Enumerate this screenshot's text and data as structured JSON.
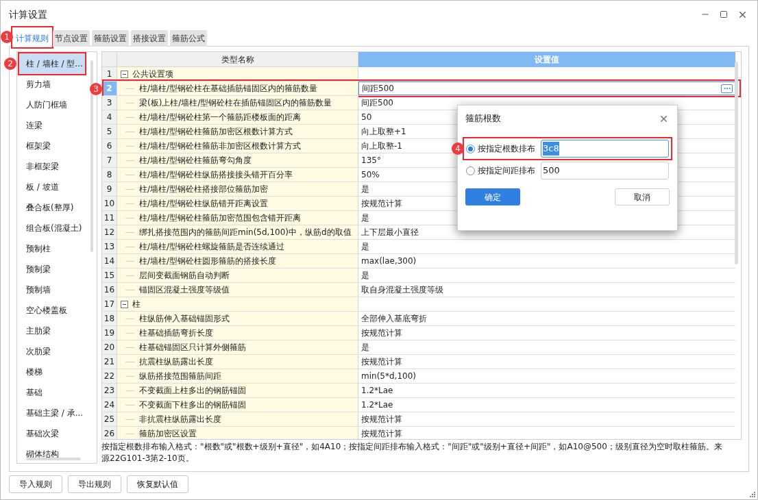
{
  "window": {
    "title": "计算设置"
  },
  "tabs": [
    {
      "label": "计算规则",
      "selected": true,
      "callout": "1"
    },
    {
      "label": "节点设置",
      "selected": false
    },
    {
      "label": "箍筋设置",
      "selected": false
    },
    {
      "label": "搭接设置",
      "selected": false
    },
    {
      "label": "箍筋公式",
      "selected": false
    }
  ],
  "sidebar": {
    "items": [
      {
        "label": "柱 / 墙柱 / 型...",
        "selected": true,
        "callout": "2"
      },
      {
        "label": "剪力墙",
        "selected": false
      },
      {
        "label": "人防门框墙",
        "selected": false
      },
      {
        "label": "连梁",
        "selected": false
      },
      {
        "label": "框架梁",
        "selected": false
      },
      {
        "label": "非框架梁",
        "selected": false
      },
      {
        "label": "板 / 坡道",
        "selected": false
      },
      {
        "label": "叠合板(整厚)",
        "selected": false
      },
      {
        "label": "组合板(混凝土)",
        "selected": false
      },
      {
        "label": "预制柱",
        "selected": false
      },
      {
        "label": "预制梁",
        "selected": false
      },
      {
        "label": "预制墙",
        "selected": false
      },
      {
        "label": "空心楼盖板",
        "selected": false
      },
      {
        "label": "主肋梁",
        "selected": false
      },
      {
        "label": "次肋梁",
        "selected": false
      },
      {
        "label": "楼梯",
        "selected": false
      },
      {
        "label": "基础",
        "selected": false
      },
      {
        "label": "基础主梁 / 承...",
        "selected": false
      },
      {
        "label": "基础次梁",
        "selected": false
      },
      {
        "label": "砌体结构",
        "selected": false
      }
    ]
  },
  "table": {
    "columns": [
      "类型名称",
      "设置值"
    ],
    "rows": [
      {
        "number": "1",
        "kind": "group",
        "expanded": true,
        "name": "公共设置项",
        "selected": false
      },
      {
        "number": "2",
        "kind": "item",
        "name": "柱/墙柱/型钢砼柱在基础插筋锚固区内的箍筋数量",
        "value": "间距500",
        "selected": true,
        "callout": "3"
      },
      {
        "number": "3",
        "kind": "item",
        "name": "梁(板)上柱/墙柱/型钢砼柱在插筋锚固区内的箍筋数量",
        "value": "间距500",
        "selected": false
      },
      {
        "number": "4",
        "kind": "item",
        "name": "柱/墙柱/型钢砼柱第一个箍筋距楼板面的距离",
        "value": "50",
        "selected": false
      },
      {
        "number": "5",
        "kind": "item",
        "name": "柱/墙柱/型钢砼柱箍筋加密区根数计算方式",
        "value": "向上取整+1",
        "selected": false
      },
      {
        "number": "6",
        "kind": "item",
        "name": "柱/墙柱/型钢砼柱箍筋非加密区根数计算方式",
        "value": "向上取整-1",
        "selected": false
      },
      {
        "number": "7",
        "kind": "item",
        "name": "柱/墙柱/型钢砼柱箍筋弯勾角度",
        "value": "135°",
        "selected": false
      },
      {
        "number": "8",
        "kind": "item",
        "name": "柱/墙柱/型钢砼柱纵筋搭接接头错开百分率",
        "value": "50%",
        "selected": false
      },
      {
        "number": "9",
        "kind": "item",
        "name": "柱/墙柱/型钢砼柱搭接部位箍筋加密",
        "value": "是",
        "selected": false
      },
      {
        "number": "10",
        "kind": "item",
        "name": "柱/墙柱/型钢砼柱纵筋错开距离设置",
        "value": "按规范计算",
        "selected": false
      },
      {
        "number": "11",
        "kind": "item",
        "name": "柱/墙柱/型钢砼柱箍筋加密范围包含错开距离",
        "value": "是",
        "selected": false
      },
      {
        "number": "12",
        "kind": "item",
        "name": "绑扎搭接范围内的箍筋间距min(5d,100)中，纵筋d的取值",
        "value": "上下层最小直径",
        "selected": false
      },
      {
        "number": "13",
        "kind": "item",
        "name": "柱/墙柱/型钢砼柱螺旋箍筋是否连续通过",
        "value": "是",
        "selected": false
      },
      {
        "number": "14",
        "kind": "item",
        "name": "柱/墙柱/型钢砼柱圆形箍筋的搭接长度",
        "value": "max(lae,300)",
        "selected": false
      },
      {
        "number": "15",
        "kind": "item",
        "name": "层间变截面钢筋自动判断",
        "value": "是",
        "selected": false
      },
      {
        "number": "16",
        "kind": "item",
        "name": "锚固区混凝土强度等级值",
        "value": "取自身混凝土强度等级",
        "selected": false
      },
      {
        "number": "17",
        "kind": "group",
        "expanded": true,
        "name": "柱",
        "selected": false
      },
      {
        "number": "18",
        "kind": "item",
        "name": "柱纵筋伸入基础锚固形式",
        "value": "全部伸入基底弯折",
        "selected": false
      },
      {
        "number": "19",
        "kind": "item",
        "name": "柱基础插筋弯折长度",
        "value": "按规范计算",
        "selected": false
      },
      {
        "number": "20",
        "kind": "item",
        "name": "柱基础锚固区只计算外侧箍筋",
        "value": "是",
        "selected": false
      },
      {
        "number": "21",
        "kind": "item",
        "name": "抗震柱纵筋露出长度",
        "value": "按规范计算",
        "selected": false
      },
      {
        "number": "22",
        "kind": "item",
        "name": "纵筋搭接范围箍筋间距",
        "value": "min(5*d,100)",
        "selected": false
      },
      {
        "number": "23",
        "kind": "item",
        "name": "不变截面上柱多出的钢筋锚固",
        "value": "1.2*Lae",
        "selected": false
      },
      {
        "number": "24",
        "kind": "item",
        "name": "不变截面下柱多出的钢筋锚固",
        "value": "1.2*Lae",
        "selected": false
      },
      {
        "number": "25",
        "kind": "item",
        "name": "非抗震柱纵筋露出长度",
        "value": "按规范计算",
        "selected": false
      },
      {
        "number": "26",
        "kind": "item",
        "name": "箍筋加密区设置",
        "value": "按规范计算",
        "selected": false
      }
    ]
  },
  "note": "按指定根数排布输入格式：\"根数\"或\"根数+级别+直径\"，如4A10；按指定间距排布输入格式：\"间距\"或\"级别+直径+间距\"，如A10@500；级别直径为空时取柱箍筋。来源22G101-3第2-10页。",
  "buttons": [
    "导入规则",
    "导出规则",
    "恢复默认值"
  ],
  "dialog": {
    "title": "箍筋根数",
    "options": [
      {
        "label": "按指定根数排布",
        "value": "3c8",
        "selected": true,
        "callout": "4"
      },
      {
        "label": "按指定间距排布",
        "value": "500",
        "selected": false
      }
    ],
    "ok": "确定",
    "cancel": "取消"
  }
}
